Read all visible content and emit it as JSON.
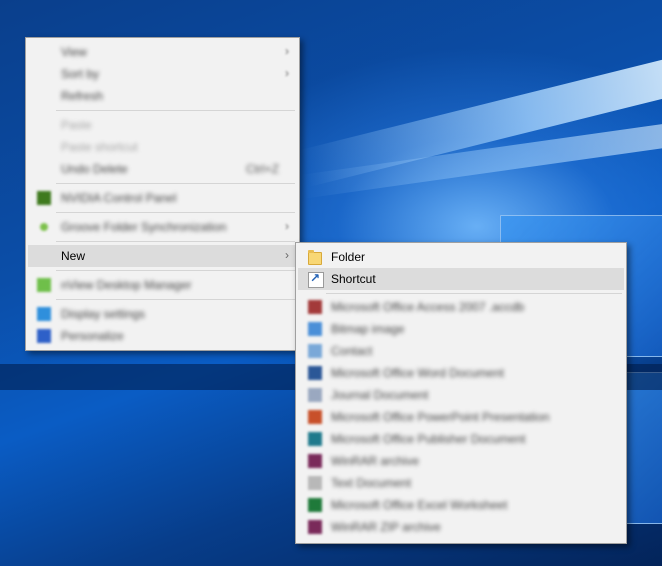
{
  "context_menu": {
    "items": [
      {
        "label": "View",
        "state": "blurred",
        "submenu": true
      },
      {
        "label": "Sort by",
        "state": "blurred",
        "submenu": true
      },
      {
        "label": "Refresh",
        "state": "blurred"
      },
      {
        "label": "Paste",
        "state": "disabled"
      },
      {
        "label": "Paste shortcut",
        "state": "disabled"
      },
      {
        "label": "Undo Delete",
        "state": "blurred",
        "shortcut": "Ctrl+Z"
      },
      {
        "label": "NVIDIA Control Panel",
        "state": "blurred",
        "icon": "nvidia-icon",
        "icon_color": "#3f7a1e"
      },
      {
        "label": "Groove Folder Synchronization",
        "state": "blurred",
        "icon": "groove-icon",
        "icon_color": "#7cc04a",
        "submenu": true
      },
      {
        "label": "New",
        "state": "highlighted",
        "submenu": true
      },
      {
        "label": "nView Desktop Manager",
        "state": "blurred",
        "icon": "nview-icon",
        "icon_color": "#6fbf4a"
      },
      {
        "label": "Display settings",
        "state": "blurred",
        "icon": "display-icon",
        "icon_color": "#2f8fdc"
      },
      {
        "label": "Personalize",
        "state": "blurred",
        "icon": "personalize-icon",
        "icon_color": "#2e60c8"
      }
    ]
  },
  "new_submenu": {
    "items": [
      {
        "label": "Folder",
        "icon": "folder-icon",
        "state": "normal"
      },
      {
        "label": "Shortcut",
        "icon": "shortcut-icon",
        "state": "highlighted"
      },
      {
        "label": "Microsoft Office Access 2007 .accdb",
        "state": "blurred",
        "icon": "access-icon",
        "icon_color": "#a33a3a"
      },
      {
        "label": "Bitmap image",
        "state": "blurred",
        "icon": "bitmap-icon",
        "icon_color": "#4a8fd8"
      },
      {
        "label": "Contact",
        "state": "blurred",
        "icon": "contact-icon",
        "icon_color": "#7aa8d8"
      },
      {
        "label": "Microsoft Office Word Document",
        "state": "blurred",
        "icon": "word-icon",
        "icon_color": "#2b5797"
      },
      {
        "label": "Journal Document",
        "state": "blurred",
        "icon": "journal-icon",
        "icon_color": "#9aa8c0"
      },
      {
        "label": "Microsoft Office PowerPoint Presentation",
        "state": "blurred",
        "icon": "powerpoint-icon",
        "icon_color": "#c8502a"
      },
      {
        "label": "Microsoft Office Publisher Document",
        "state": "blurred",
        "icon": "publisher-icon",
        "icon_color": "#1f7a8c"
      },
      {
        "label": "WinRAR archive",
        "state": "blurred",
        "icon": "winrar-icon",
        "icon_color": "#7a2a5a"
      },
      {
        "label": "Text Document",
        "state": "blurred",
        "icon": "text-icon",
        "icon_color": "#b8b8b8"
      },
      {
        "label": "Microsoft Office Excel Worksheet",
        "state": "blurred",
        "icon": "excel-icon",
        "icon_color": "#1f7a3a"
      },
      {
        "label": "WinRAR ZIP archive",
        "state": "blurred",
        "icon": "winrar-zip-icon",
        "icon_color": "#7a2a5a"
      }
    ]
  },
  "colors": {
    "menu_bg": "#f2f2f2",
    "highlight": "#dcdcdc",
    "desktop": "#0b4ea8"
  }
}
